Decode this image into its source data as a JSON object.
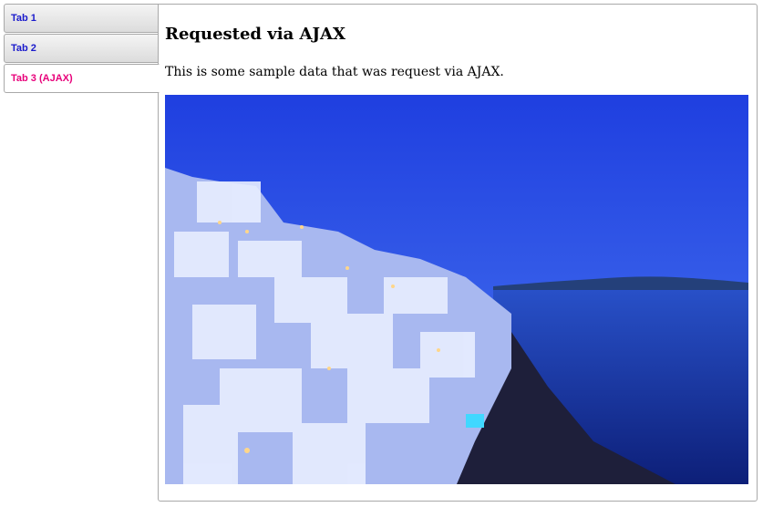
{
  "tabs": [
    {
      "label": "Tab 1"
    },
    {
      "label": "Tab 2"
    },
    {
      "label": "Tab 3 (AJAX)"
    }
  ],
  "active_tab": 2,
  "panel": {
    "heading": "Requested via AJAX",
    "text": "This is some sample data that was request via AJAX."
  },
  "colors": {
    "tab_text": "#1a1acc",
    "active_tab_text": "#e8007a",
    "sky": "#2a55e8",
    "sea": "#1c3aa8"
  }
}
